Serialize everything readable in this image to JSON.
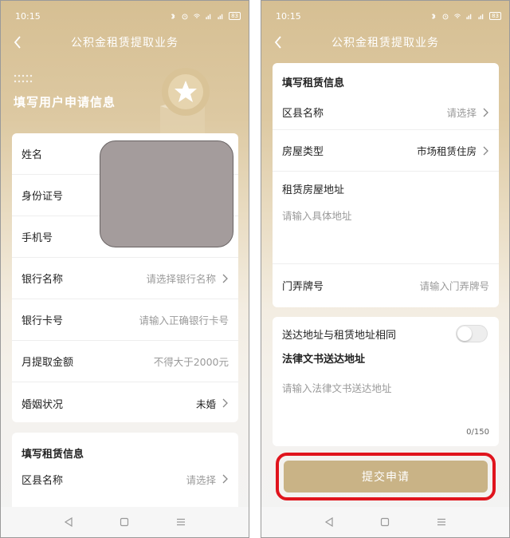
{
  "status": {
    "time": "10:15",
    "battery": "83"
  },
  "nav": {
    "title": "公积金租赁提取业务"
  },
  "left": {
    "hero_title": "填写用户申请信息",
    "user_rows": [
      {
        "label": "姓名",
        "value": ""
      },
      {
        "label": "身份证号",
        "value": ""
      },
      {
        "label": "手机号",
        "value": ""
      },
      {
        "label": "银行名称",
        "value": "请选择银行名称"
      },
      {
        "label": "银行卡号",
        "value": "请输入正确银行卡号"
      },
      {
        "label": "月提取金额",
        "value": "不得大于2000元"
      },
      {
        "label": "婚姻状况",
        "value": "未婚"
      }
    ],
    "rent_section_title": "填写租赁信息",
    "rent_rows": [
      {
        "label": "区县名称",
        "value": "请选择"
      }
    ]
  },
  "right": {
    "rent_section_title": "填写租赁信息",
    "district": {
      "label": "区县名称",
      "value": "请选择"
    },
    "house_type": {
      "label": "房屋类型",
      "value": "市场租赁住房"
    },
    "address_label": "租赁房屋地址",
    "address_placeholder": "请输入具体地址",
    "door_no": {
      "label": "门弄牌号",
      "placeholder": "请输入门弄牌号"
    },
    "same_address_label": "送达地址与租赁地址相同",
    "legal_label": "法律文书送达地址",
    "legal_placeholder": "请输入法律文书送达地址",
    "legal_counter": "0/150",
    "submit_label": "提交申请"
  },
  "colors": {
    "gold": "#c9b386",
    "highlight_red": "#e0141d",
    "mask_gray": "#a49c9c"
  }
}
